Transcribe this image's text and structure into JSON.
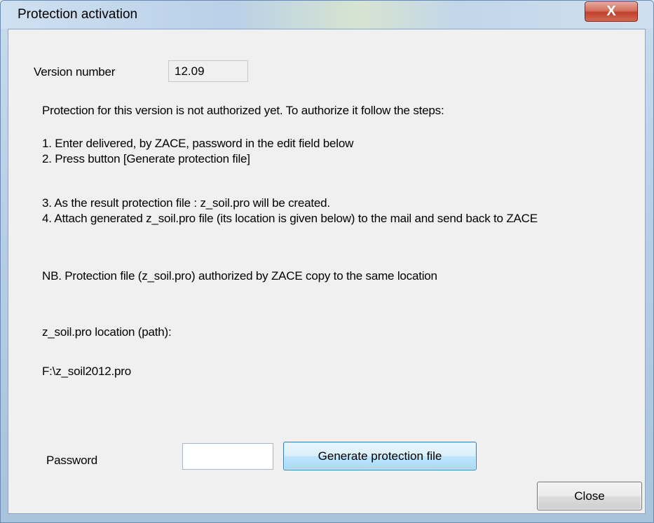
{
  "window": {
    "title": "Protection activation",
    "close_glyph": "X"
  },
  "version": {
    "label": "Version number",
    "value": "12.09"
  },
  "instructions": {
    "intro": "Protection for this version is not authorized yet. To authorize it follow the steps:",
    "step1": "1. Enter delivered, by ZACE, password in the edit field below",
    "step2": "2. Press button [Generate protection file]",
    "step3": "3. As the result protection file : z_soil.pro will be created.",
    "step4": "4. Attach generated z_soil.pro file (its location is given below) to the mail and send back to ZACE",
    "nb": "NB.  Protection file (z_soil.pro) authorized by ZACE copy to the same location"
  },
  "location": {
    "label": "z_soil.pro location (path):",
    "path": "F:\\z_soil2012.pro"
  },
  "password": {
    "label": "Password",
    "value": "",
    "generate_label": "Generate protection file"
  },
  "footer": {
    "close_label": "Close"
  }
}
